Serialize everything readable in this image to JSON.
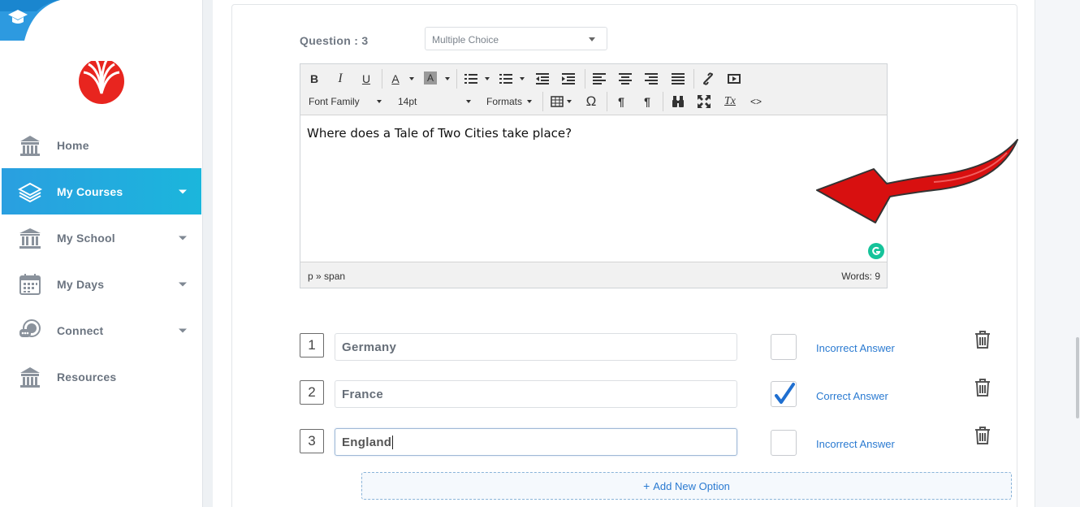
{
  "sidebar": {
    "items": [
      {
        "label": "Home",
        "icon": "school-building-icon",
        "active": false,
        "has_caret": false
      },
      {
        "label": "My Courses",
        "icon": "stack-layers-icon",
        "active": true,
        "has_caret": true
      },
      {
        "label": "My School",
        "icon": "institution-columns-icon",
        "active": false,
        "has_caret": true
      },
      {
        "label": "My Days",
        "icon": "calendar-icon",
        "active": false,
        "has_caret": true
      },
      {
        "label": "Connect",
        "icon": "chat-bubbles-icon",
        "active": false,
        "has_caret": true
      },
      {
        "label": "Resources",
        "icon": "school-building-icon",
        "active": false,
        "has_caret": false
      }
    ],
    "accent_color": "#27a6de",
    "logo_color": "#e8251f"
  },
  "question": {
    "label": "Question : 3",
    "type_selected": "Multiple Choice",
    "text": "Where does a Tale of Two Cities take place?"
  },
  "editor": {
    "toolbar": {
      "bold": "B",
      "italic": "I",
      "underline": "U",
      "text_color": "A",
      "bg_color": "A",
      "font_family": "Font Family",
      "font_size": "14pt",
      "formats": "Formats",
      "special_char": "Ω",
      "clear_format": "Tx",
      "code": "<>"
    },
    "status_path": "p » span",
    "word_count": "Words: 9"
  },
  "options": [
    {
      "number": "1",
      "value": "Germany",
      "checked": false,
      "status": "Incorrect Answer",
      "focused": false
    },
    {
      "number": "2",
      "value": "France",
      "checked": true,
      "status": "Correct Answer",
      "focused": false
    },
    {
      "number": "3",
      "value": "England",
      "checked": false,
      "status": "Incorrect Answer",
      "focused": true
    }
  ],
  "add_option_label": "Add New Option",
  "add_option_prefix": "+"
}
